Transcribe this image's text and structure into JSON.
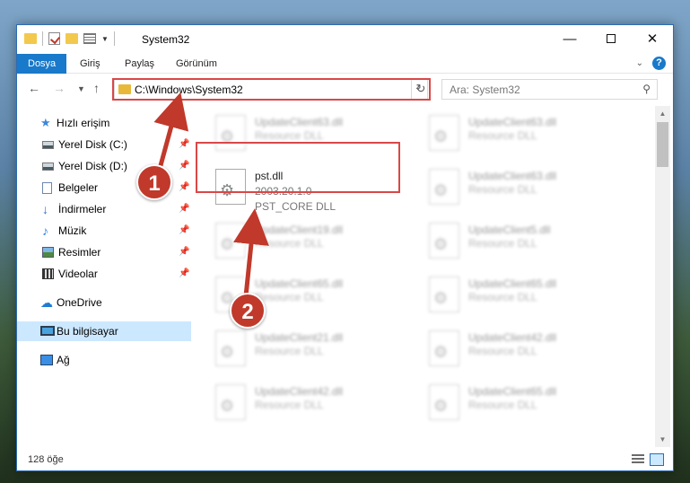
{
  "window": {
    "title": "System32",
    "controls": {
      "minimize": "—",
      "maximize": "",
      "close": "✕"
    }
  },
  "ribbon": {
    "tabs": [
      "Dosya",
      "Giriş",
      "Paylaş",
      "Görünüm"
    ],
    "active_tab": "Dosya",
    "help": "?"
  },
  "address": {
    "path": "C:\\Windows\\System32",
    "search_placeholder": "Ara: System32"
  },
  "nav_pane": {
    "quick_access": "Hızlı erişim",
    "items": [
      {
        "label": "Yerel Disk (C:)",
        "icon": "drive-icon",
        "pinned": true
      },
      {
        "label": "Yerel Disk (D:)",
        "icon": "drive-icon",
        "pinned": true
      },
      {
        "label": "Belgeler",
        "icon": "documents-icon",
        "pinned": true
      },
      {
        "label": "İndirmeler",
        "icon": "downloads-icon",
        "pinned": true
      },
      {
        "label": "Müzik",
        "icon": "music-icon",
        "pinned": true
      },
      {
        "label": "Resimler",
        "icon": "pictures-icon",
        "pinned": true
      },
      {
        "label": "Videolar",
        "icon": "videos-icon",
        "pinned": true
      }
    ],
    "onedrive": "OneDrive",
    "this_pc": "Bu bilgisayar",
    "network": "Ağ"
  },
  "files": {
    "highlighted": {
      "name": "pst.dll",
      "version": "2003.20.1.0",
      "description": "PST_CORE DLL"
    },
    "left_column": [
      {
        "name": "UpdateClient63.dll",
        "type": "Resource DLL"
      },
      {
        "name": "UpdateClient19.dll",
        "type": "Resource DLL"
      },
      {
        "name": "UpdateClient65.dll",
        "type": "Resource DLL"
      },
      {
        "name": "UpdateClient21.dll",
        "type": "Resource DLL"
      },
      {
        "name": "UpdateClient42.dll",
        "type": "Resource DLL"
      }
    ],
    "right_column": [
      {
        "name": "UpdateClient63.dll",
        "type": "Resource DLL"
      },
      {
        "name": "UpdateClient63.dll",
        "type": "Resource DLL"
      },
      {
        "name": "UpdateClient5.dll",
        "type": "Resource DLL"
      },
      {
        "name": "UpdateClient65.dll",
        "type": "Resource DLL"
      },
      {
        "name": "UpdateClient42.dll",
        "type": "Resource DLL"
      },
      {
        "name": "UpdateClient65.dll",
        "type": "Resource DLL"
      }
    ]
  },
  "status": {
    "count": "128 öğe"
  },
  "annotations": {
    "marker_1": "1",
    "marker_2": "2",
    "highlight_color": "#d94848"
  }
}
